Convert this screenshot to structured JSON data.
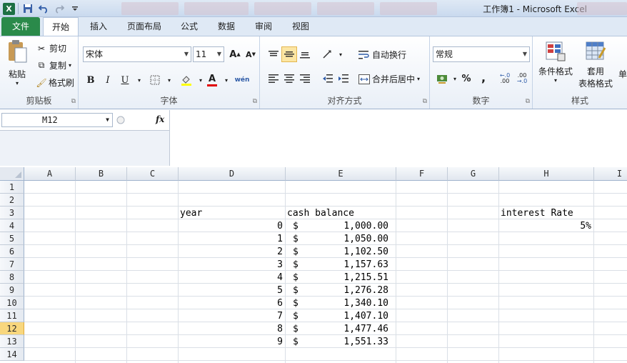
{
  "window": {
    "title": "工作簿1 - Microsoft Excel",
    "app_icon": "X"
  },
  "ribbon_tabs": [
    "文件",
    "开始",
    "插入",
    "页面布局",
    "公式",
    "数据",
    "审阅",
    "视图"
  ],
  "clipboard": {
    "paste": "粘贴",
    "cut": "剪切",
    "copy": "复制",
    "format_painter": "格式刷",
    "group_label": "剪贴板"
  },
  "font": {
    "name": "宋体",
    "size": "11",
    "grow": "A",
    "shrink": "A",
    "bold": "B",
    "italic": "I",
    "underline": "U",
    "group_label": "字体"
  },
  "alignment": {
    "wrap_text": "自动换行",
    "merge_center": "合并后居中",
    "group_label": "对齐方式"
  },
  "number": {
    "format": "常规",
    "percent": "%",
    "comma": ",",
    "group_label": "数字"
  },
  "styles": {
    "conditional_format": "条件格式",
    "format_table_line1": "套用",
    "format_table_line2": "表格格式",
    "cell_styles": "单",
    "group_label": "样式"
  },
  "formula_bar": {
    "name_box": "M12",
    "fx": "fx",
    "value": ""
  },
  "columns": [
    "A",
    "B",
    "C",
    "D",
    "E",
    "F",
    "G",
    "H",
    "I"
  ],
  "rows": [
    "1",
    "2",
    "3",
    "4",
    "5",
    "6",
    "7",
    "8",
    "9",
    "10",
    "11",
    "12",
    "13",
    "14"
  ],
  "active_row": "12",
  "sheet": {
    "D3": "year",
    "E3": "cash balance",
    "H3": "interest Rate",
    "H4": "5%",
    "years": [
      "0",
      "1",
      "2",
      "3",
      "4",
      "5",
      "6",
      "7",
      "8",
      "9"
    ],
    "currency_symbol": "$",
    "balances": [
      "1,000.00",
      "1,050.00",
      "1,102.50",
      "1,157.63",
      "1,215.51",
      "1,276.28",
      "1,340.10",
      "1,407.10",
      "1,477.46",
      "1,551.33"
    ]
  },
  "colors": {
    "file_tab": "#2a8a4a",
    "active_row_header": "#f8d77e",
    "ribbon_bg": "#dfe9f5"
  }
}
